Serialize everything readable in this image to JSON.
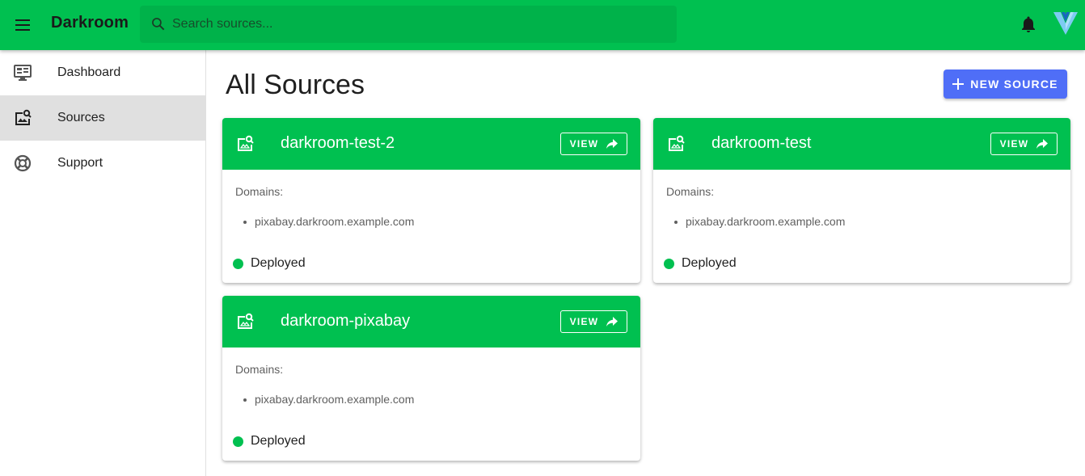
{
  "app": {
    "title": "Darkroom"
  },
  "search": {
    "placeholder": "Search sources..."
  },
  "sidebar": {
    "items": [
      {
        "label": "Dashboard",
        "icon": "monitor-dashboard-icon"
      },
      {
        "label": "Sources",
        "icon": "image-search-icon",
        "active": true
      },
      {
        "label": "Support",
        "icon": "lifebuoy-icon"
      }
    ]
  },
  "main": {
    "title": "All Sources",
    "new_button": "NEW SOURCE",
    "cards": [
      {
        "name": "darkroom-test-2",
        "view_label": "VIEW",
        "domains_label": "Domains:",
        "domains": [
          "pixabay.darkroom.example.com"
        ],
        "status": "Deployed"
      },
      {
        "name": "darkroom-test",
        "view_label": "VIEW",
        "domains_label": "Domains:",
        "domains": [
          "pixabay.darkroom.example.com"
        ],
        "status": "Deployed"
      },
      {
        "name": "darkroom-pixabay",
        "view_label": "VIEW",
        "domains_label": "Domains:",
        "domains": [
          "pixabay.darkroom.example.com"
        ],
        "status": "Deployed"
      }
    ]
  },
  "colors": {
    "primary": "#00c050",
    "accent": "#4f6ef7",
    "status_deployed": "#00c050"
  }
}
